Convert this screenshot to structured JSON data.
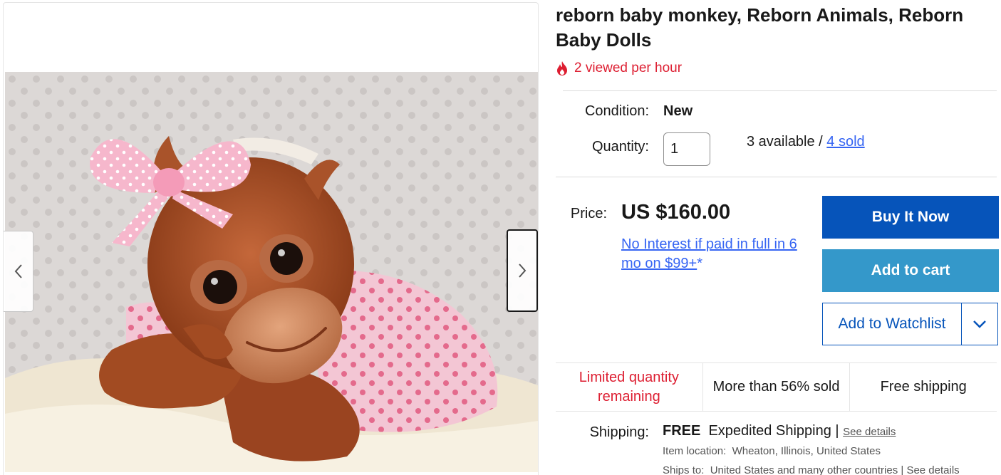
{
  "listing": {
    "title": "reborn baby monkey, Reborn Animals, Reborn Baby Dolls",
    "views": "2 viewed per hour"
  },
  "condition": {
    "label": "Condition:",
    "value": "New"
  },
  "quantity": {
    "label": "Quantity:",
    "value": "1",
    "available": "3 available",
    "separator": " / ",
    "sold_link": "4 sold"
  },
  "price": {
    "label": "Price:",
    "amount": "US $160.00",
    "financing_link": "No Interest if paid in full in 6 mo on $99+",
    "financing_suffix": "*"
  },
  "actions": {
    "buy_now": "Buy It Now",
    "add_to_cart": "Add to cart",
    "watchlist": "Add to Watchlist"
  },
  "signals": [
    "Limited quantity remaining",
    "More than 56% sold",
    "Free shipping"
  ],
  "shipping": {
    "label": "Shipping:",
    "free": "FREE",
    "method": "Expedited Shipping",
    "divider": "|",
    "details_link": "See details",
    "location_label": "Item location:",
    "location": "Wheaton, Illinois, United States",
    "ships_to_label": "Ships to:",
    "ships_to": "United States and many other countries",
    "ships_to_details": "See details"
  },
  "gallery": {
    "image": "reborn baby orangutan doll with pink polka-dot bow and outfit",
    "prev_icon": "chevron-left-icon",
    "next_icon": "chevron-right-icon"
  },
  "colors": {
    "accent_blue": "#3665f3",
    "buy_button": "#0654ba",
    "cart_button": "#3498ca",
    "urgent_red": "#dd1e31"
  }
}
